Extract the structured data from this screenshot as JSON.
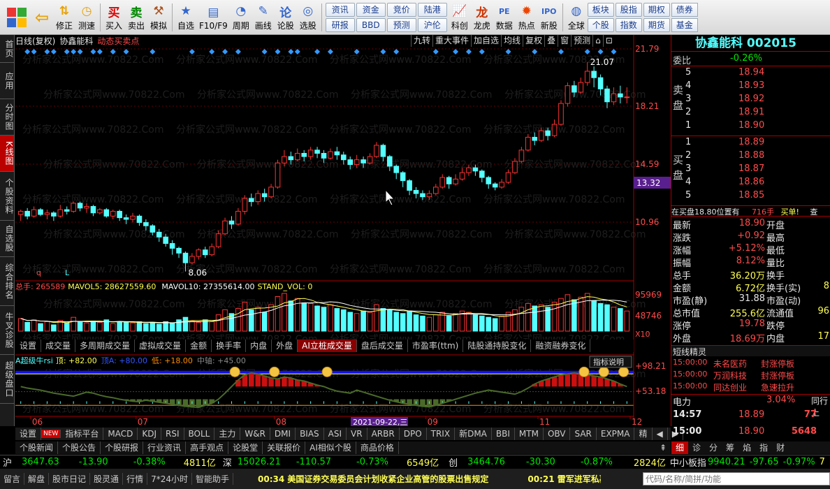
{
  "toolbar": {
    "buttons": [
      {
        "label": "",
        "icon": "back-arrow-icon"
      },
      {
        "label": "修正",
        "icon": "up-down-icon"
      },
      {
        "label": "测速",
        "icon": "clock-icon"
      },
      {
        "label": "买入",
        "icon": "buy-icon"
      },
      {
        "label": "卖出",
        "icon": "sell-icon"
      },
      {
        "label": "模拟",
        "icon": "hammer-icon"
      },
      {
        "label": "自选",
        "icon": "star-icon"
      },
      {
        "label": "F10/F9",
        "icon": "f10-icon"
      },
      {
        "label": "周期",
        "icon": "cycle-icon"
      },
      {
        "label": "画线",
        "icon": "pencil-icon"
      },
      {
        "label": "论股",
        "icon": "chat-icon"
      },
      {
        "label": "选股",
        "icon": "select-icon"
      }
    ],
    "grid": [
      "资讯",
      "资金",
      "竞价",
      "陆港",
      "研报",
      "BBD",
      "预测",
      "沪伦"
    ],
    "buttons2": [
      {
        "label": "科创",
        "icon": "chart-icon"
      },
      {
        "label": "龙虎",
        "icon": "dragon-icon"
      },
      {
        "label": "数据",
        "icon": "pe-icon"
      },
      {
        "label": "热点",
        "icon": "hot-icon"
      },
      {
        "label": "新股",
        "icon": "ipo-icon"
      },
      {
        "label": "全球",
        "icon": "globe-icon"
      }
    ],
    "grid2": [
      "板块",
      "股指",
      "期权",
      "个股",
      "指数",
      "期货"
    ],
    "extra": [
      "债券",
      "基金"
    ]
  },
  "lefttabs": [
    "首页",
    "应用",
    "分时图",
    "K线图",
    "个股资料",
    "自选股",
    "综合排名",
    "牛叉诊股",
    "超级盘口"
  ],
  "chart": {
    "period": "日线(复权)",
    "stock": "协鑫能科",
    "mode": "动态买卖点",
    "top_buttons": [
      "九转",
      "重大事件",
      "加自选",
      "均线",
      "复权",
      "叠",
      "窗",
      "预测"
    ],
    "price_ticks": [
      "21.79",
      "18.21",
      "14.59",
      "10.96"
    ],
    "current_price": "13.32",
    "max_label": "21.07",
    "min_label": "8.06",
    "watermark": "分析家公式网www.70822.Com",
    "marks": [
      "q",
      "L"
    ]
  },
  "chart_data": {
    "type": "candlestick",
    "candles": [
      [
        11.6,
        11.8,
        11.2,
        11.9
      ],
      [
        11.8,
        11.5,
        11.3,
        12
      ],
      [
        11.5,
        11.9,
        11.4,
        12.1
      ],
      [
        11.9,
        11.6,
        11.5,
        12
      ],
      [
        11.6,
        11.7,
        11.3,
        11.9
      ],
      [
        11.7,
        11.5,
        11.2,
        11.8
      ],
      [
        11.5,
        11.9,
        11.4,
        12.2
      ],
      [
        11.9,
        11.8,
        11.6,
        12.1
      ],
      [
        11.8,
        12.3,
        11.7,
        12.4
      ],
      [
        12.3,
        12,
        11.8,
        12.4
      ],
      [
        12,
        12.1,
        11.7,
        12.3
      ],
      [
        12.1,
        11.7,
        11.5,
        12.2
      ],
      [
        11.7,
        11.9,
        11.6,
        12
      ],
      [
        11.9,
        11.5,
        11.4,
        12
      ],
      [
        11.5,
        11.8,
        11.3,
        11.9
      ],
      [
        11.8,
        11.4,
        11.2,
        11.9
      ],
      [
        11.4,
        11.3,
        11,
        11.6
      ],
      [
        11.3,
        11.5,
        11.1,
        11.7
      ],
      [
        11.5,
        11.1,
        10.9,
        11.6
      ],
      [
        11.1,
        10.9,
        10.6,
        11.3
      ],
      [
        10.9,
        10.5,
        10.3,
        11
      ],
      [
        10.5,
        10.2,
        9.9,
        10.7
      ],
      [
        10.2,
        9.8,
        9.6,
        10.4
      ],
      [
        9.8,
        9.5,
        9.1,
        10
      ],
      [
        9.5,
        9.2,
        8.9,
        9.6
      ],
      [
        9.2,
        8.6,
        8.06,
        9.3
      ],
      [
        8.6,
        9,
        8.5,
        9.2
      ],
      [
        9,
        9.4,
        8.8,
        9.5
      ],
      [
        9.4,
        9.1,
        8.9,
        9.6
      ],
      [
        9.1,
        9.6,
        9,
        9.8
      ],
      [
        9.6,
        10.4,
        9.5,
        10.6
      ],
      [
        10.4,
        11.2,
        10.3,
        11.4
      ],
      [
        11.2,
        11,
        10.7,
        11.5
      ],
      [
        11,
        11.8,
        10.9,
        12
      ],
      [
        11.8,
        12.6,
        11.6,
        12.8
      ],
      [
        12.6,
        12.4,
        12.1,
        12.9
      ],
      [
        12.4,
        12.9,
        12.2,
        13.1
      ],
      [
        12.9,
        12.7,
        12.4,
        13.2
      ],
      [
        12.7,
        13.3,
        12.6,
        13.5
      ],
      [
        13.3,
        14.8,
        13.2,
        15
      ],
      [
        14.8,
        15.2,
        14.6,
        15.6
      ],
      [
        15.2,
        15,
        14.7,
        15.5
      ],
      [
        15,
        15.4,
        14.9,
        15.7
      ],
      [
        15.4,
        15.2,
        14.9,
        15.6
      ],
      [
        15.2,
        15.6,
        15,
        15.8
      ],
      [
        15.6,
        15.4,
        15.1,
        15.8
      ],
      [
        15.4,
        15.1,
        14.8,
        15.6
      ],
      [
        15.1,
        15.5,
        15,
        15.7
      ],
      [
        15.5,
        15.3,
        15,
        15.8
      ],
      [
        15.3,
        15,
        14.7,
        15.5
      ],
      [
        15,
        14.7,
        14.4,
        15.2
      ],
      [
        14.7,
        15,
        14.5,
        15.3
      ],
      [
        15,
        14.8,
        14.5,
        15.2
      ],
      [
        14.8,
        15.2,
        14.7,
        15.4
      ],
      [
        15.2,
        15.9,
        15.1,
        16.1
      ],
      [
        15.9,
        15.2,
        14.9,
        16
      ],
      [
        15.2,
        14.6,
        14.3,
        15.3
      ],
      [
        14.6,
        14.2,
        13.8,
        14.7
      ],
      [
        14.2,
        13.7,
        13.3,
        14.3
      ],
      [
        13.7,
        13.1,
        12.8,
        13.8
      ],
      [
        13.1,
        12.9,
        12.6,
        13.3
      ],
      [
        12.9,
        12.7,
        12.5,
        13.1
      ],
      [
        12.7,
        12.9,
        12.5,
        13.1
      ],
      [
        12.9,
        13.3,
        12.8,
        13.5
      ],
      [
        13.3,
        13.9,
        13.2,
        14.1
      ],
      [
        13.9,
        13.5,
        13.2,
        14
      ],
      [
        13.5,
        13.8,
        13.4,
        14.1
      ],
      [
        13.8,
        14.2,
        13.7,
        14.5
      ],
      [
        14.2,
        14.5,
        14,
        14.7
      ],
      [
        14.5,
        14.3,
        14,
        14.7
      ],
      [
        14.3,
        13.9,
        13.6,
        14.4
      ],
      [
        13.9,
        13.5,
        13.2,
        14
      ],
      [
        13.5,
        13.3,
        13.1,
        13.6
      ],
      [
        13.3,
        13.6,
        13.2,
        13.8
      ],
      [
        13.6,
        14.2,
        13.5,
        14.4
      ],
      [
        14.2,
        14.9,
        14.1,
        15.1
      ],
      [
        14.9,
        15.6,
        14.8,
        15.8
      ],
      [
        15.6,
        16.4,
        15.5,
        16.6
      ],
      [
        16.4,
        16.2,
        15.9,
        16.7
      ],
      [
        16.2,
        16.8,
        16.1,
        17
      ],
      [
        16.8,
        16.5,
        16.2,
        17
      ],
      [
        16.5,
        17.2,
        16.4,
        17.5
      ],
      [
        17.2,
        18.5,
        17.1,
        18.7
      ],
      [
        18.5,
        19.6,
        18.3,
        19.8
      ],
      [
        19.6,
        19.2,
        18.9,
        19.9
      ],
      [
        19.2,
        19.8,
        19.1,
        20.1
      ],
      [
        19.8,
        20.5,
        19.6,
        21.07
      ],
      [
        20.5,
        20.1,
        19.5,
        20.8
      ],
      [
        20.1,
        19.4,
        19,
        20.3
      ],
      [
        19.4,
        18.6,
        18.2,
        19.6
      ],
      [
        18.6,
        19.1,
        18.4,
        19.5
      ],
      [
        19.1,
        18.9,
        18.5,
        19.6
      ],
      [
        18.9,
        18.9,
        18.5,
        19.5
      ]
    ],
    "ylim": [
      8,
      21.8
    ],
    "x_ticks": [
      {
        "index": 2,
        "label": "06"
      },
      {
        "index": 18,
        "label": "07"
      },
      {
        "index": 39,
        "label": "08"
      },
      {
        "index": 62,
        "label": "09"
      },
      {
        "index": 79,
        "label": "11"
      },
      {
        "index": 93,
        "label": "12"
      }
    ],
    "highlight_date": "2021-09-22,三",
    "volume_header": {
      "total": "总手: 265589",
      "ma5": "MAVOL5: 28627559.60",
      "ma10": "MAVOL10: 27355614.00",
      "std": "STAND_VOL: 0"
    },
    "volume_ticks": [
      "95969",
      "48746",
      "X10"
    ],
    "volume": [
      20,
      14,
      18,
      12,
      15,
      10,
      17,
      13,
      22,
      15,
      13,
      16,
      14,
      18,
      12,
      15,
      14,
      13,
      15,
      12,
      14,
      11,
      15,
      13,
      18,
      22,
      16,
      14,
      18,
      15,
      26,
      34,
      28,
      36,
      46,
      34,
      38,
      30,
      42,
      55,
      60,
      48,
      52,
      45,
      44,
      40,
      38,
      42,
      36,
      34,
      30,
      28,
      32,
      30,
      42,
      36,
      34,
      30,
      28,
      32,
      26,
      24,
      22,
      26,
      30,
      24,
      28,
      32,
      30,
      26,
      24,
      22,
      20,
      24,
      30,
      34,
      38,
      44,
      40,
      42,
      38,
      46,
      52,
      58,
      50,
      54,
      60,
      48,
      44,
      42,
      38,
      36,
      32
    ],
    "rsi_header": {
      "name": "A超级牛rsi",
      "top": "顶: +82.00",
      "mid": "顶A: +80.00",
      "low": "低: +18.00",
      "axis": "中轴: +45.00"
    },
    "rsi_ticks": [
      "+98.21",
      "+53.18"
    ],
    "rsi": [
      55,
      52,
      50,
      48,
      45,
      42,
      40,
      38,
      36,
      40,
      44,
      42,
      38,
      35,
      33,
      30,
      28,
      26,
      25,
      28,
      26,
      24,
      22,
      20,
      18,
      16,
      15,
      14,
      18,
      22,
      30,
      42,
      55,
      68,
      78,
      82,
      80,
      76,
      72,
      70,
      74,
      72,
      68,
      66,
      62,
      58,
      55,
      50,
      46,
      44,
      42,
      48,
      44,
      40,
      36,
      32,
      28,
      25,
      22,
      20,
      18,
      16,
      15,
      18,
      22,
      26,
      30,
      34,
      38,
      42,
      45,
      48,
      46,
      44,
      42,
      40,
      45,
      52,
      60,
      66,
      70,
      74,
      78,
      80,
      82,
      80,
      78,
      76,
      74,
      70,
      66,
      60,
      55
    ]
  },
  "volume_tabs": [
    "设置",
    "成交量",
    "多周期成交量",
    "虚拟成交量",
    "金额",
    "换手率",
    "内盘",
    "外盘",
    "AI立桩成交量",
    "盘后成交量",
    "市盈率(ttm)",
    "陆股通持股变化",
    "融资融券变化"
  ],
  "indicator_tabs": [
    "设置",
    "NEW",
    "指标平台",
    "MACD",
    "KDJ",
    "RSI",
    "BOLL",
    "主力",
    "W&R",
    "DMI",
    "BIAS",
    "ASI",
    "VR",
    "ARBR",
    "DPO",
    "TRIX",
    "新DMA",
    "BBI",
    "MTM",
    "OBV",
    "SAR",
    "EXPMA",
    "精"
  ],
  "explain_btn": "指标说明",
  "news_tabs": [
    "个股新闻",
    "个股公告",
    "个股研报",
    "行业资讯",
    "高手观点",
    "论股堂",
    "关联报价",
    "AI相似个股",
    "商品价格"
  ],
  "quote": {
    "name": "协鑫能科",
    "code": "002015",
    "webi_label": "委比",
    "webi_value": "-0.26%",
    "sell_label": "卖盘",
    "buy_label": "买盘",
    "sells": [
      {
        "lvl": "5",
        "price": "18.94"
      },
      {
        "lvl": "4",
        "price": "18.93"
      },
      {
        "lvl": "3",
        "price": "18.92"
      },
      {
        "lvl": "2",
        "price": "18.91"
      },
      {
        "lvl": "1",
        "price": "18.90"
      }
    ],
    "buys": [
      {
        "lvl": "1",
        "price": "18.89"
      },
      {
        "lvl": "2",
        "price": "18.88"
      },
      {
        "lvl": "3",
        "price": "18.87"
      },
      {
        "lvl": "4",
        "price": "18.86"
      },
      {
        "lvl": "5",
        "price": "18.85"
      }
    ],
    "notice_a": "在买盘18.80位置有",
    "notice_b": "716手",
    "notice_c": "买单!",
    "notice_d": "查",
    "stats": [
      {
        "l": "最新",
        "v": "18.90",
        "l2": "开盘",
        "v2": ""
      },
      {
        "l": "涨跌",
        "v": "+0.92",
        "l2": "最高",
        "v2": ""
      },
      {
        "l": "涨幅",
        "v": "+5.12%",
        "l2": "最低",
        "v2": ""
      },
      {
        "l": "振幅",
        "v": "8.12%",
        "l2": "量比",
        "v2": ""
      },
      {
        "l": "总手",
        "v": "36.20万",
        "l2": "换手",
        "v2": ""
      },
      {
        "l": "金额",
        "v": "6.72亿",
        "l2": "换手(实)",
        "v2": "8"
      },
      {
        "l": "市盈(静)",
        "v": "31.88",
        "l2": "市盈(动)",
        "v2": ""
      },
      {
        "l": "总市值",
        "v": "255.6亿",
        "l2": "流通值",
        "v2": "96"
      },
      {
        "l": "涨停",
        "v": "19.78",
        "l2": "跌停",
        "v2": ""
      },
      {
        "l": "外盘",
        "v": "18.69万",
        "l2": "内盘",
        "v2": "17"
      }
    ],
    "shortline_title": "短线精灵",
    "shortline": [
      {
        "t": "15:00:00",
        "n": "未名医药",
        "e": "封涨停板"
      },
      {
        "t": "15:00:00",
        "n": "万润科技",
        "e": "封涨停板"
      },
      {
        "t": "15:00:00",
        "n": "同达创业",
        "e": "急速拉升"
      }
    ],
    "industry": "电力",
    "industry_pct": "3.04%",
    "industry_btn": "同行上",
    "ticks": [
      {
        "t": "14:57",
        "p": "18.89",
        "v": "77"
      },
      {
        "t": "15:00",
        "p": "18.90",
        "v": "5648"
      }
    ],
    "bottom_tabs": [
      "细",
      "诊",
      "分",
      "筹",
      "焰",
      "指",
      "财"
    ]
  },
  "index_bar": {
    "sh": {
      "n": "沪",
      "p": "3647.63",
      "c": "-13.90",
      "pct": "-0.38%",
      "amt": "4811亿"
    },
    "sz": {
      "n": "深",
      "p": "15026.21",
      "c": "-110.57",
      "pct": "-0.73%",
      "amt": "6549亿"
    },
    "cy": {
      "n": "创",
      "p": "3464.76",
      "c": "-30.30",
      "pct": "-0.87%",
      "amt": "2824亿"
    },
    "zx": {
      "n": "中小板指",
      "p": "9940.21",
      "c": "-97.65",
      "pct": "-0.97%",
      "amt": "7"
    }
  },
  "status": {
    "items": [
      "留言",
      "解盘",
      "股市日记",
      "股灵通",
      "行情",
      "7*24小时",
      "智能助手"
    ],
    "news1": "00:34 美国证券交易委员会计划收紧企业高管的股票出售规定",
    "news2": "00:21 雷军进军私募 小米",
    "search_placeholder": "代码/名称/简拼/功能"
  }
}
